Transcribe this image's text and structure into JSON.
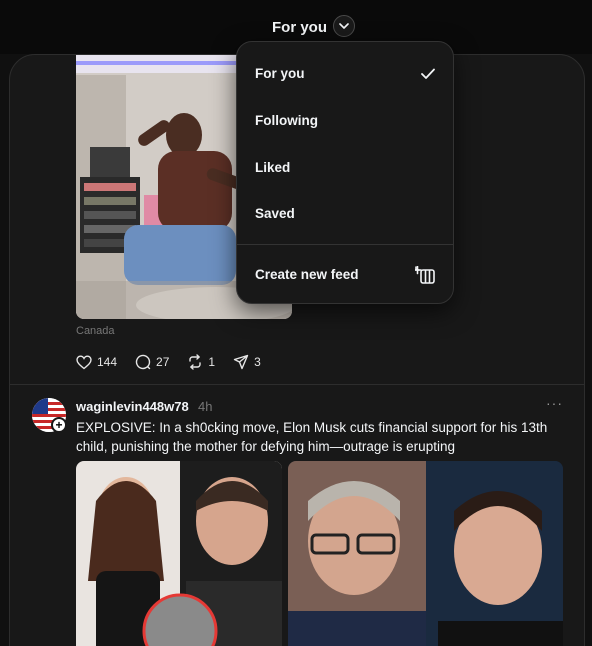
{
  "header": {
    "feed_title": "For you",
    "toggle_icon": "chevron-down-icon"
  },
  "post1": {
    "location": "Canada",
    "likes": "144",
    "replies": "27",
    "reposts": "1",
    "shares": "3"
  },
  "post2": {
    "username": "waginlevin448w78",
    "time": "4h",
    "more": "···",
    "text": "EXPLOSIVE: In a sh0cking move, Elon Musk cuts financial support for his 13th child, punishing the mother for defying him—outrage is erupting"
  },
  "menu": {
    "items": [
      {
        "label": "For you",
        "selected": true
      },
      {
        "label": "Following"
      },
      {
        "label": "Liked"
      },
      {
        "label": "Saved"
      }
    ],
    "create_label": "Create new feed"
  }
}
